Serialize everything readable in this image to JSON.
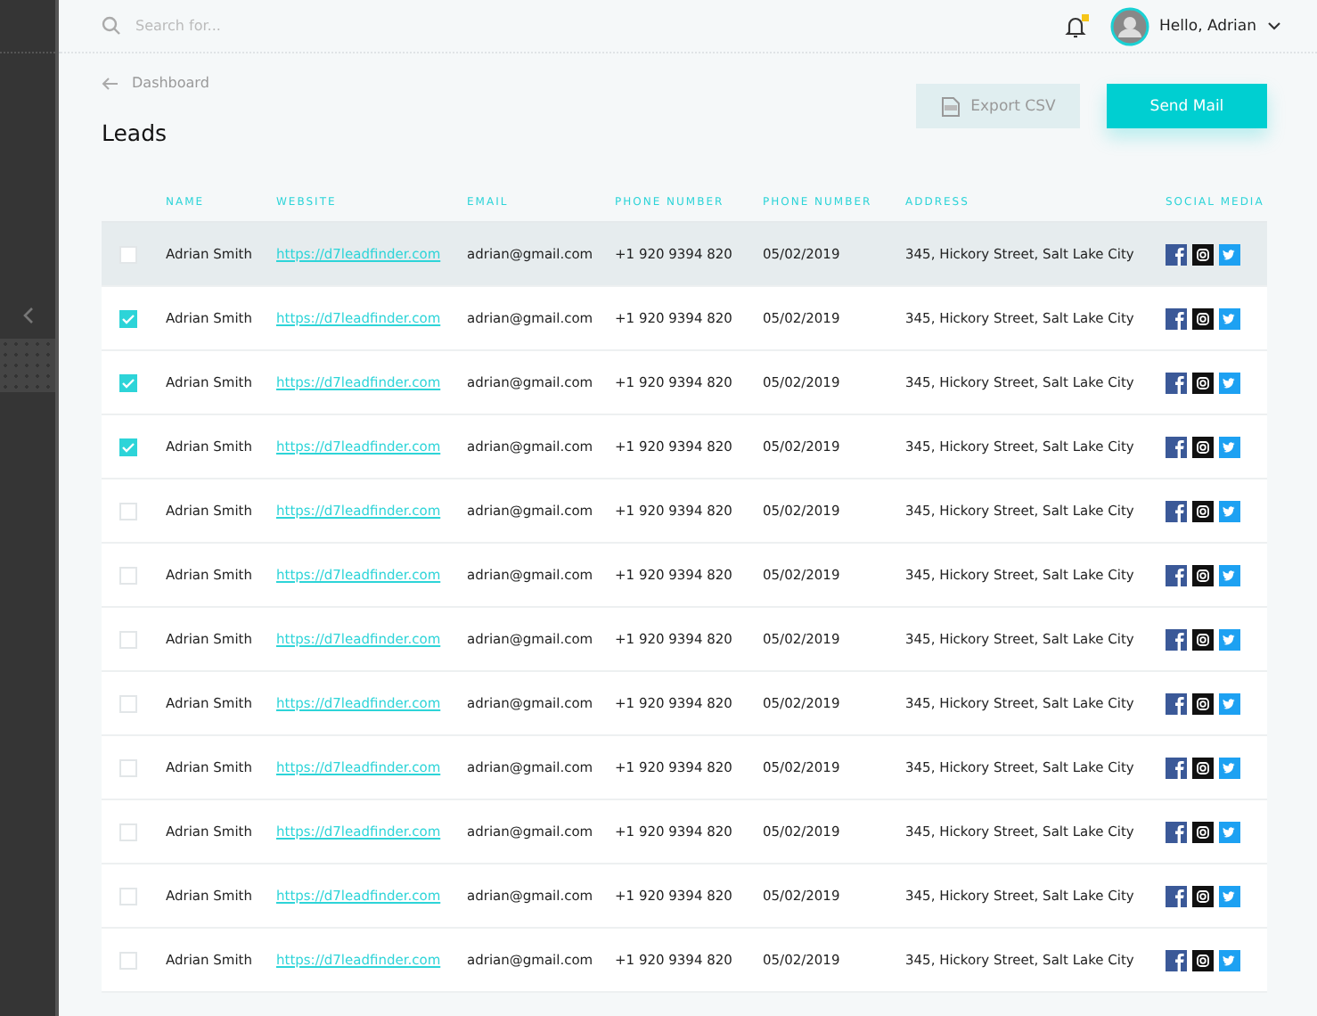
{
  "search": {
    "placeholder": "Search for..."
  },
  "header": {
    "notification_unread": true,
    "greeting": "Hello, Adrian"
  },
  "breadcrumb": "Dashboard",
  "title": "Leads",
  "buttons": {
    "export": {
      "label": "Export CSV",
      "disabled": true
    },
    "send": {
      "label": "Send Mail"
    }
  },
  "table": {
    "columns": [
      "NAME",
      "WEBSITE",
      "EMAIL",
      "PHONE NUMBER",
      "PHONE NUMBER",
      "ADDRESS",
      "SOCIAL MEDIA"
    ],
    "rows": [
      {
        "checked": false,
        "hovered": true,
        "name": "Adrian Smith",
        "website": "https://d7leadfinder.com",
        "email": "adrian@gmail.com",
        "phone": "+1 920 9394 820",
        "date": "05/02/2019",
        "address": "345, Hickory Street, Salt Lake City"
      },
      {
        "checked": true,
        "hovered": false,
        "name": "Adrian Smith",
        "website": "https://d7leadfinder.com",
        "email": "adrian@gmail.com",
        "phone": "+1 920 9394 820",
        "date": "05/02/2019",
        "address": "345, Hickory Street, Salt Lake City"
      },
      {
        "checked": true,
        "hovered": false,
        "name": "Adrian Smith",
        "website": "https://d7leadfinder.com",
        "email": "adrian@gmail.com",
        "phone": "+1 920 9394 820",
        "date": "05/02/2019",
        "address": "345, Hickory Street, Salt Lake City"
      },
      {
        "checked": true,
        "hovered": false,
        "name": "Adrian Smith",
        "website": "https://d7leadfinder.com",
        "email": "adrian@gmail.com",
        "phone": "+1 920 9394 820",
        "date": "05/02/2019",
        "address": "345, Hickory Street, Salt Lake City"
      },
      {
        "checked": false,
        "hovered": false,
        "name": "Adrian Smith",
        "website": "https://d7leadfinder.com",
        "email": "adrian@gmail.com",
        "phone": "+1 920 9394 820",
        "date": "05/02/2019",
        "address": "345, Hickory Street, Salt Lake City"
      },
      {
        "checked": false,
        "hovered": false,
        "name": "Adrian Smith",
        "website": "https://d7leadfinder.com",
        "email": "adrian@gmail.com",
        "phone": "+1 920 9394 820",
        "date": "05/02/2019",
        "address": "345, Hickory Street, Salt Lake City"
      },
      {
        "checked": false,
        "hovered": false,
        "name": "Adrian Smith",
        "website": "https://d7leadfinder.com",
        "email": "adrian@gmail.com",
        "phone": "+1 920 9394 820",
        "date": "05/02/2019",
        "address": "345, Hickory Street, Salt Lake City"
      },
      {
        "checked": false,
        "hovered": false,
        "name": "Adrian Smith",
        "website": "https://d7leadfinder.com",
        "email": "adrian@gmail.com",
        "phone": "+1 920 9394 820",
        "date": "05/02/2019",
        "address": "345, Hickory Street, Salt Lake City"
      },
      {
        "checked": false,
        "hovered": false,
        "name": "Adrian Smith",
        "website": "https://d7leadfinder.com",
        "email": "adrian@gmail.com",
        "phone": "+1 920 9394 820",
        "date": "05/02/2019",
        "address": "345, Hickory Street, Salt Lake City"
      },
      {
        "checked": false,
        "hovered": false,
        "name": "Adrian Smith",
        "website": "https://d7leadfinder.com",
        "email": "adrian@gmail.com",
        "phone": "+1 920 9394 820",
        "date": "05/02/2019",
        "address": "345, Hickory Street, Salt Lake City"
      },
      {
        "checked": false,
        "hovered": false,
        "name": "Adrian Smith",
        "website": "https://d7leadfinder.com",
        "email": "adrian@gmail.com",
        "phone": "+1 920 9394 820",
        "date": "05/02/2019",
        "address": "345, Hickory Street, Salt Lake City"
      },
      {
        "checked": false,
        "hovered": false,
        "name": "Adrian Smith",
        "website": "https://d7leadfinder.com",
        "email": "adrian@gmail.com",
        "phone": "+1 920 9394 820",
        "date": "05/02/2019",
        "address": "345, Hickory Street, Salt Lake City"
      }
    ]
  }
}
